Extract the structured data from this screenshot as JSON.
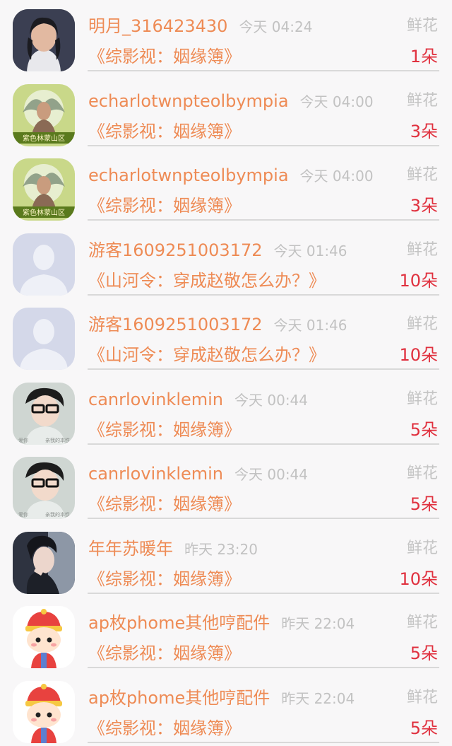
{
  "rows": [
    {
      "avatar": "avatar-photo-woman",
      "name": "明月_316423430",
      "time": "今天 04:24",
      "type": "鲜花",
      "book": "《综影视：姻缘簿》",
      "count": "1朵"
    },
    {
      "avatar": "avatar-smoke-figure",
      "name": "echarlotwnpteolbympia",
      "time": "今天 04:00",
      "type": "鲜花",
      "book": "《综影视：姻缘簿》",
      "count": "3朵",
      "avatar_caption": "紫色林蒙山区"
    },
    {
      "avatar": "avatar-smoke-figure",
      "name": "echarlotwnpteolbympia",
      "time": "今天 04:00",
      "type": "鲜花",
      "book": "《综影视：姻缘簿》",
      "count": "3朵",
      "avatar_caption": "紫色林蒙山区"
    },
    {
      "avatar": "avatar-default-silhouette",
      "name": "游客1609251003172",
      "time": "今天 01:46",
      "type": "鲜花",
      "book": "《山河令：穿成赵敬怎么办？》",
      "count": "10朵"
    },
    {
      "avatar": "avatar-default-silhouette",
      "name": "游客1609251003172",
      "time": "今天 01:46",
      "type": "鲜花",
      "book": "《山河令：穿成赵敬怎么办？》",
      "count": "10朵"
    },
    {
      "avatar": "avatar-glasses-man",
      "name": "canrlovinklemin",
      "time": "今天 00:44",
      "type": "鲜花",
      "book": "《综影视：姻缘簿》",
      "count": "5朵",
      "avatar_caption_left": "爱你",
      "avatar_caption_right": "亲我的本性"
    },
    {
      "avatar": "avatar-glasses-man",
      "name": "canrlovinklemin",
      "time": "今天 00:44",
      "type": "鲜花",
      "book": "《综影视：姻缘簿》",
      "count": "5朵",
      "avatar_caption_left": "爱你",
      "avatar_caption_right": "亲我的本性"
    },
    {
      "avatar": "avatar-photo-portrait",
      "name": "年年苏暖年",
      "time": "昨天 23:20",
      "type": "鲜花",
      "book": "《综影视：姻缘簿》",
      "count": "10朵"
    },
    {
      "avatar": "avatar-cartoon-boy",
      "name": "ap枚phome其他哼配件",
      "time": "昨天 22:04",
      "type": "鲜花",
      "book": "《综影视：姻缘簿》",
      "count": "5朵"
    },
    {
      "avatar": "avatar-cartoon-boy",
      "name": "ap枚phome其他哼配件",
      "time": "昨天 22:04",
      "type": "鲜花",
      "book": "《综影视：姻缘簿》",
      "count": "5朵"
    }
  ],
  "colors": {
    "name": "#ee8b55",
    "time": "#c2c2c2",
    "count": "#e0303e",
    "background": "#f8f7f8"
  }
}
